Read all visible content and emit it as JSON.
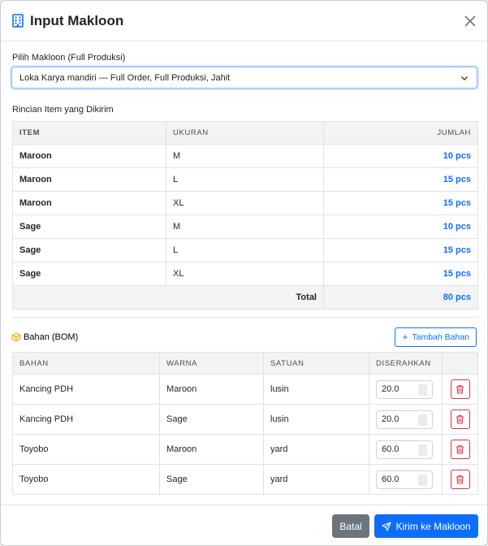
{
  "modal": {
    "title": "Input Makloon",
    "icon": "building-icon"
  },
  "makloon_select": {
    "label": "Pilih Makloon (Full Produksi)",
    "value": "Loka Karya mandiri — Full Order, Full Produksi, Jahit"
  },
  "items_section": {
    "label": "Rincian Item yang Dikirim",
    "headers": [
      "ITEM",
      "UKURAN",
      "JUMLAH"
    ],
    "rows": [
      {
        "item": "Maroon",
        "size": "M",
        "qty": "10 pcs"
      },
      {
        "item": "Maroon",
        "size": "L",
        "qty": "15 pcs"
      },
      {
        "item": "Maroon",
        "size": "XL",
        "qty": "15 pcs"
      },
      {
        "item": "Sage",
        "size": "M",
        "qty": "10 pcs"
      },
      {
        "item": "Sage",
        "size": "L",
        "qty": "15 pcs"
      },
      {
        "item": "Sage",
        "size": "XL",
        "qty": "15 pcs"
      }
    ],
    "total_label": "Total",
    "total_value": "80 pcs"
  },
  "bom_section": {
    "title": "Bahan (BOM)",
    "icon": "box-icon",
    "add_button": "Tambah Bahan",
    "headers": [
      "BAHAN",
      "WARNA",
      "SATUAN",
      "DISERAHKAN",
      ""
    ],
    "rows": [
      {
        "bahan": "Kancing PDH",
        "warna": "Maroon",
        "satuan": "lusin",
        "diserahkan": "20.0"
      },
      {
        "bahan": "Kancing PDH",
        "warna": "Sage",
        "satuan": "lusin",
        "diserahkan": "20.0"
      },
      {
        "bahan": "Toyobo",
        "warna": "Maroon",
        "satuan": "yard",
        "diserahkan": "60.0"
      },
      {
        "bahan": "Toyobo",
        "warna": "Sage",
        "satuan": "yard",
        "diserahkan": "60.0"
      }
    ]
  },
  "footer": {
    "cancel": "Batal",
    "submit": "Kirim ke Makloon"
  },
  "colors": {
    "primary": "#0d6efd",
    "danger": "#dc3545",
    "secondary": "#6c757d",
    "warning_icon": "#f0ad1e"
  }
}
